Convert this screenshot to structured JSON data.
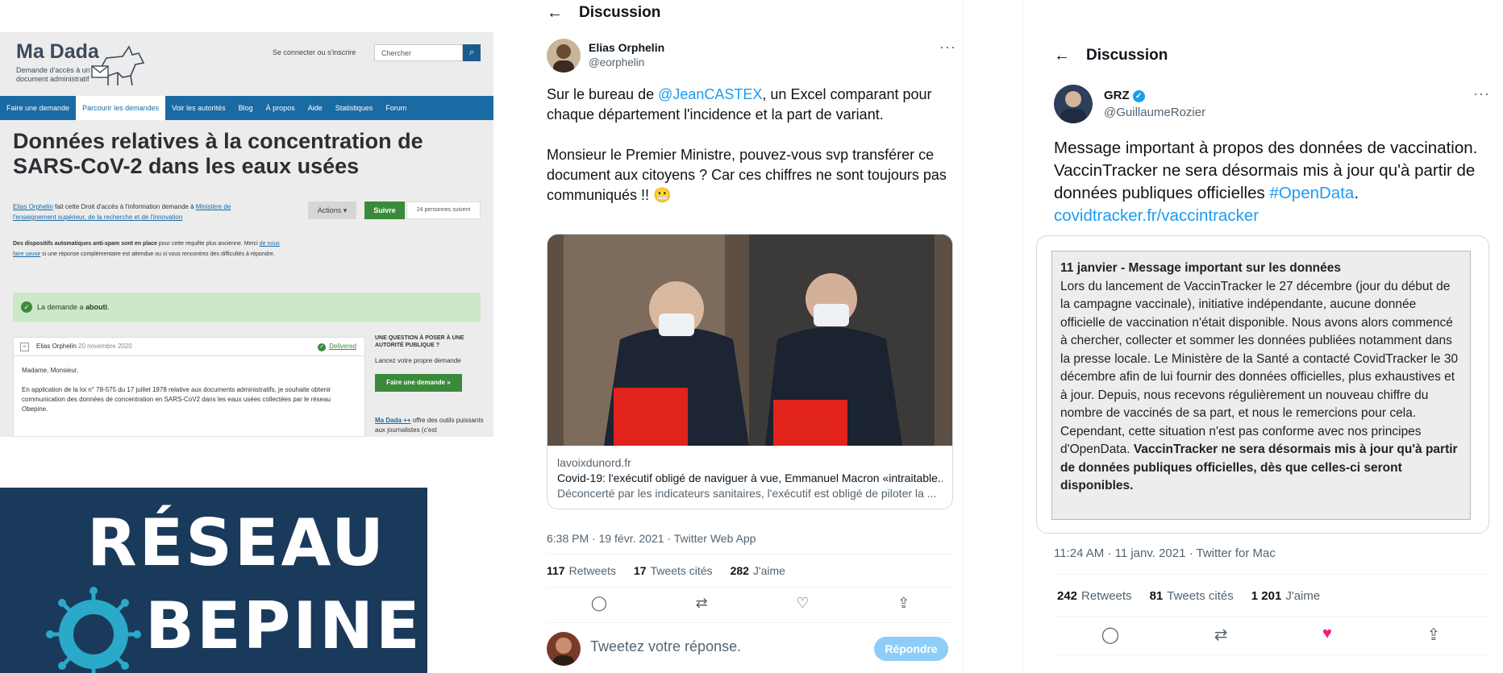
{
  "madada": {
    "brand": "Ma Dada",
    "tagline": "Demande d'accès à un document administratif",
    "login": "Se connecter ou s'inscrire",
    "search_placeholder": "Chercher",
    "nav": [
      "Faire une demande",
      "Parcourir les demandes",
      "Voir les autorités",
      "Blog",
      "À propos",
      "Aide",
      "Statistiques",
      "Forum"
    ],
    "active_nav": "Parcourir les demandes",
    "title": "Données relatives à la concentration de SARS-CoV-2 dans les eaux usées",
    "requester": "Elias Orphelin",
    "request_text": " fait cette Droit d'accès à l'information demande à ",
    "authority": "Ministère de l'enseignement supérieur, de la recherche et de l'innovation",
    "actions_label": "Actions",
    "follow_label": "Suivre",
    "followers": "24 personnes suivent",
    "antispam_bold": "Des dispositifs automatiques anti-spam sont en place",
    "antispam_text": " pour cette requête plus ancienne. Merci ",
    "antispam_link": "de nous faire savoir",
    "antispam_end": " si une réponse complémentaire est attendue ou si vous rencontrez des difficultés à répondre.",
    "status_prefix": "La demande a ",
    "status_value": "abouti",
    "status_suffix": ".",
    "msg_author": "Elias Orphelin",
    "msg_date": "20 novembre 2020",
    "msg_status": "Delivered",
    "msg_greeting": "Madame, Monsieur,",
    "msg_body": "En application de la loi n° 78-575 du 17 juillet 1978 relative aux documents administratifs, je souhaite obtenir communication des données de concentration en SARS-CoV2 dans les eaux usées collectées par le réseau Obepine.",
    "side_question": "UNE QUESTION À POSER À UNE AUTORITÉ PUBLIQUE ?",
    "side_launch": "Lancez votre propre demande",
    "side_button": "Faire une demande »",
    "side_plus_link": "Ma Dada ++",
    "side_plus_text": " offre des outils puissants aux journalistes (c'est"
  },
  "obepine": {
    "line1": "RÉSEAU",
    "line2": "BEPINE",
    "colors": {
      "background": "#1a3a5c",
      "virus": "#2aa9c9"
    }
  },
  "tweet1": {
    "header": "Discussion",
    "name": "Elias Orphelin",
    "handle": "@eorphelin",
    "text_a": "Sur le bureau de ",
    "mention": "@JeanCASTEX",
    "text_b": ", un Excel comparant pour chaque département l'incidence et la part de variant.\n\nMonsieur le Premier Ministre, pouvez-vous svp transférer ce document aux citoyens ? Car ces chiffres ne sont toujours pas communiqués !! ",
    "emoji": "😬",
    "card_domain": "lavoixdunord.fr",
    "card_title": "Covid-19: l'exécutif obligé de naviguer à vue, Emmanuel Macron «intraitable...",
    "card_desc": "Déconcerté par les indicateurs sanitaires, l'exécutif est obligé de piloter la ...",
    "meta": "6:38 PM · 19 févr. 2021 · Twitter Web App",
    "retweets": "117",
    "retweets_label": "Retweets",
    "quotes": "17",
    "quotes_label": "Tweets cités",
    "likes": "282",
    "likes_label": "J'aime",
    "reply_placeholder": "Tweetez votre réponse.",
    "reply_button": "Répondre"
  },
  "tweet2": {
    "header": "Discussion",
    "name": "GRZ",
    "handle": "@GuillaumeRozier",
    "text_a": "Message important à propos des données de vaccination. VaccinTracker ne sera désormais mis à jour qu'à partir de données publiques officielles ",
    "hashtag": "#OpenData",
    "text_b": ". ",
    "link": "covidtracker.fr/vaccintracker",
    "card_heading": "11 janvier - Message important sur les données",
    "card_body": "Lors du lancement de VaccinTracker le 27 décembre (jour du début de la campagne vaccinale), initiative indépendante, aucune donnée officielle de vaccination n'était disponible. Nous avons alors commencé à chercher, collecter et sommer les données publiées notamment dans la presse locale. Le Ministère de la Santé a contacté CovidTracker le 30 décembre afin de lui fournir des données officielles, plus exhaustives et à jour. Depuis, nous recevons régulièrement un nouveau chiffre du nombre de vaccinés de sa part, et nous le remercions pour cela. Cependant, cette situation n'est pas conforme avec nos principes d'OpenData. ",
    "card_bold": "VaccinTracker ne sera désormais mis à jour qu'à partir de données publiques officielles, dès que celles-ci seront disponibles.",
    "meta": "11:24 AM · 11 janv. 2021 · Twitter for Mac",
    "retweets": "242",
    "retweets_label": "Retweets",
    "quotes": "81",
    "quotes_label": "Tweets cités",
    "likes": "1 201",
    "likes_label": "J'aime",
    "colors": {
      "like_active": "#f91880",
      "link": "#1d9bf0"
    }
  }
}
